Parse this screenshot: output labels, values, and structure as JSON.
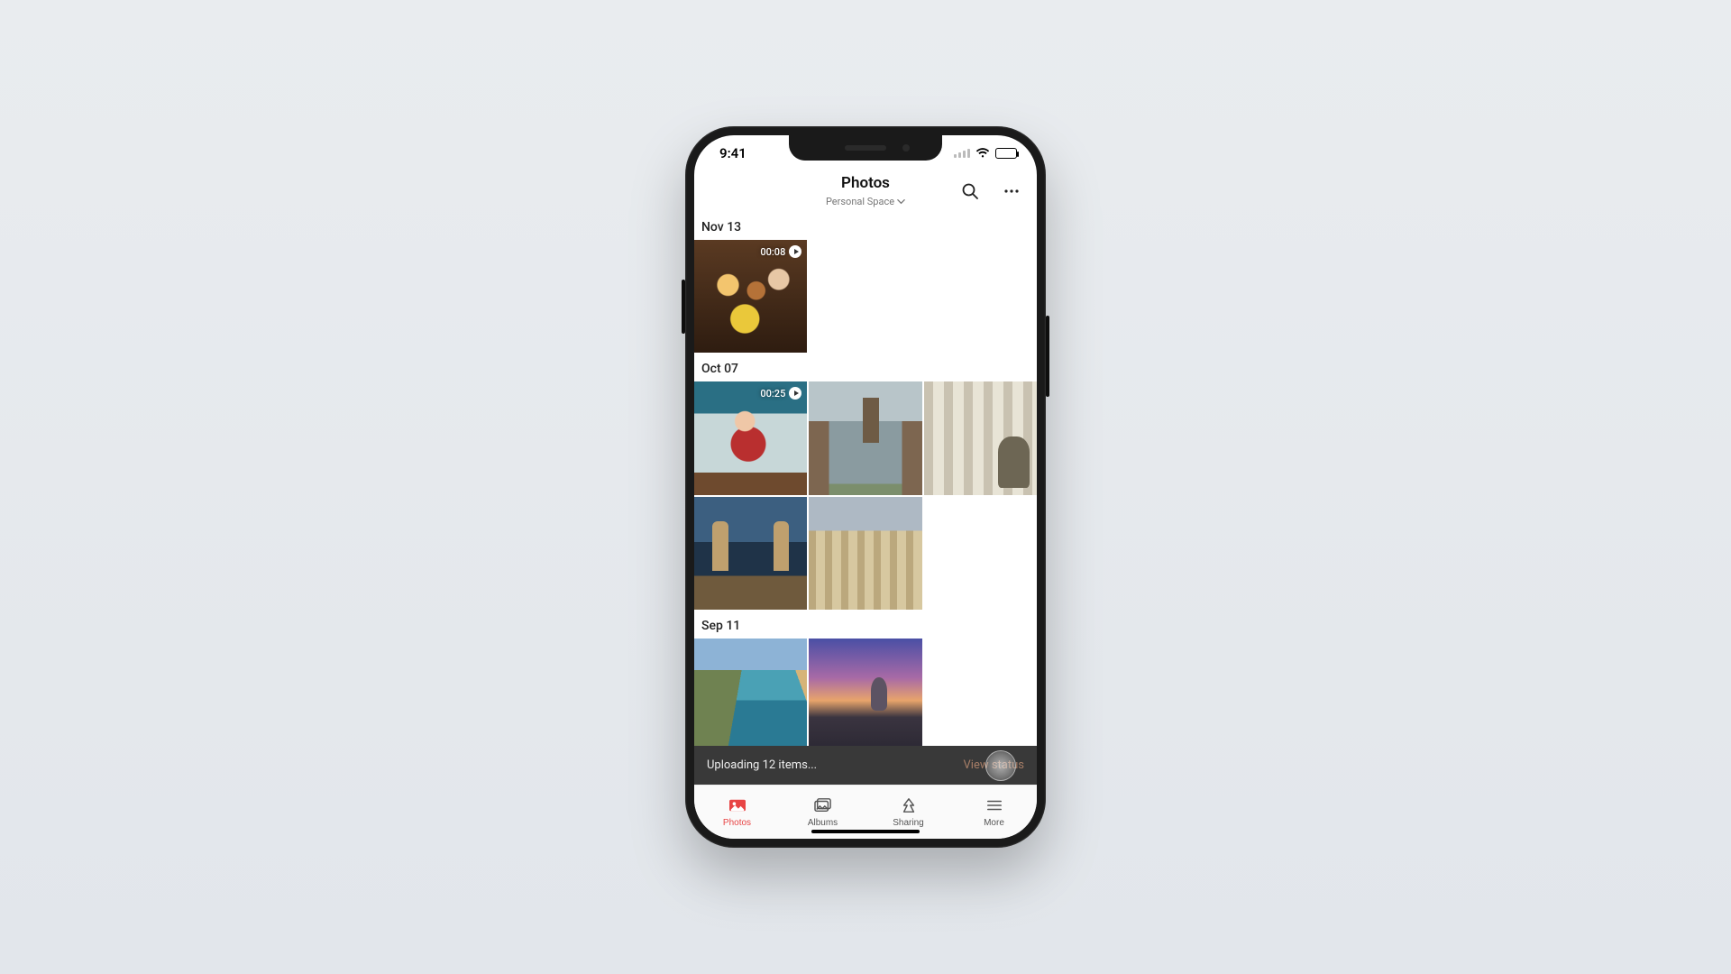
{
  "status": {
    "time": "9:41"
  },
  "header": {
    "title": "Photos",
    "subtitle": "Personal Space"
  },
  "sections": [
    {
      "date": "Nov 13",
      "items": [
        {
          "type": "video",
          "duration": "00:08",
          "style": "t-party",
          "name": "video-group-selfie"
        }
      ]
    },
    {
      "date": "Oct 07",
      "items": [
        {
          "type": "video",
          "duration": "00:25",
          "style": "t-woman",
          "name": "video-woman-reading"
        },
        {
          "type": "photo",
          "style": "t-canal",
          "name": "photo-canal-street"
        },
        {
          "type": "photo",
          "style": "t-columns",
          "name": "photo-columns-statue"
        },
        {
          "type": "photo",
          "style": "t-bridge",
          "name": "photo-tower-bridge"
        },
        {
          "type": "photo",
          "style": "t-city1",
          "name": "photo-city-aerial"
        }
      ]
    },
    {
      "date": "Sep 11",
      "items": [
        {
          "type": "photo",
          "style": "t-coast",
          "name": "photo-coastal-town"
        },
        {
          "type": "photo",
          "style": "t-sunset",
          "name": "photo-sunset-dome"
        }
      ]
    }
  ],
  "upload": {
    "text": "Uploading 12 items...",
    "action": "View status"
  },
  "tabs": [
    {
      "id": "photos",
      "label": "Photos",
      "active": true
    },
    {
      "id": "albums",
      "label": "Albums",
      "active": false
    },
    {
      "id": "sharing",
      "label": "Sharing",
      "active": false
    },
    {
      "id": "more",
      "label": "More",
      "active": false
    }
  ]
}
